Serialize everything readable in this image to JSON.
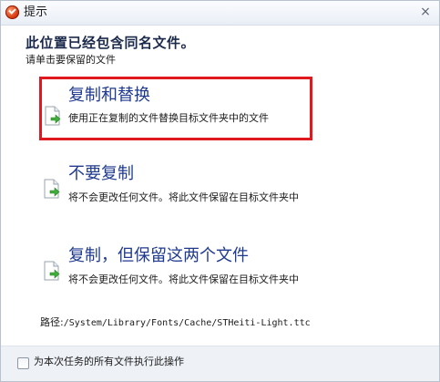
{
  "window": {
    "title": "提示",
    "close_glyph": "×"
  },
  "header": {
    "heading": "此位置已经包含同名文件。",
    "subheading": "请单击要保留的文件"
  },
  "options": [
    {
      "title": "复制和替换",
      "description": "使用正在复制的文件替换目标文件夹中的文件",
      "highlighted": true
    },
    {
      "title": "不要复制",
      "description": "将不会更改任何文件。将此文件保留在目标文件夹中",
      "highlighted": false
    },
    {
      "title": "复制，但保留这两个文件",
      "description": "将不会更改任何文件。将此文件保留在目标文件夹中",
      "highlighted": false
    }
  ],
  "path": {
    "label": "路径:",
    "value": "/System/Library/Fonts/Cache/STHeiti-Light.ttc"
  },
  "footer": {
    "checkbox_label": "为本次任务的所有文件执行此操作",
    "checked": false
  },
  "colors": {
    "highlight_border": "#e0191f",
    "option_title": "#1f3a8f",
    "heading": "#1b2a4a"
  },
  "icons": {
    "app": "app-logo-icon",
    "close": "close-icon",
    "file": "file-copy-icon"
  }
}
